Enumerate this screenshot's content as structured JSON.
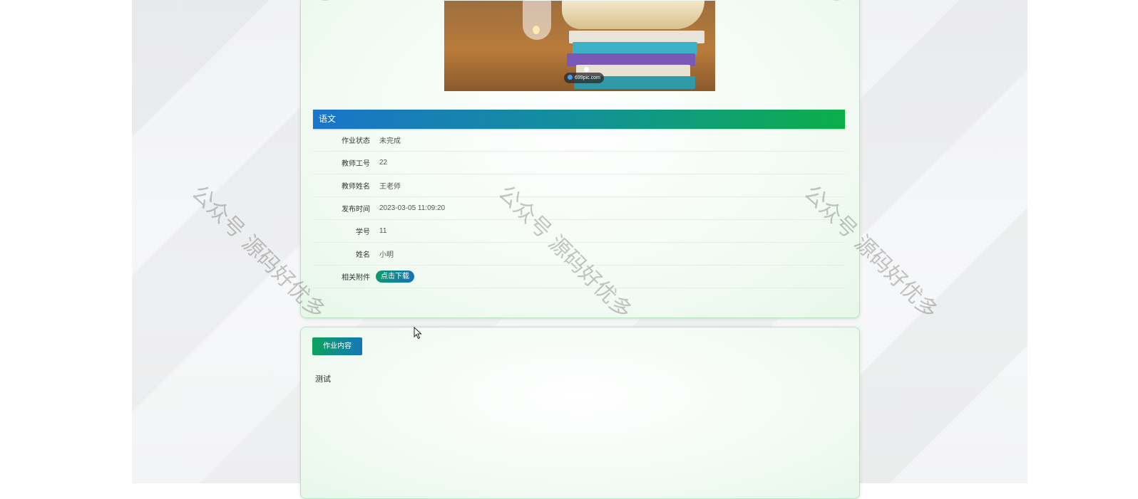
{
  "photo": {
    "watermark": "699pic.com"
  },
  "section": {
    "title": "语文"
  },
  "details": [
    {
      "label": "作业状态",
      "value": "未完成"
    },
    {
      "label": "教师工号",
      "value": "22"
    },
    {
      "label": "教师姓名",
      "value": "王老师"
    },
    {
      "label": "发布时间",
      "value": "2023-03-05 11:09:20"
    },
    {
      "label": "学号",
      "value": "11"
    },
    {
      "label": "姓名",
      "value": "小明"
    }
  ],
  "attachment": {
    "label": "相关附件",
    "button_label": "点击下载"
  },
  "content": {
    "tab_label": "作业内容",
    "text": "测试"
  },
  "watermark_text": "公众号 源码好优多",
  "colors": {
    "accent_blue": "#1a74c9",
    "accent_green": "#0cae4a",
    "card_border": "#b9e4c3"
  }
}
